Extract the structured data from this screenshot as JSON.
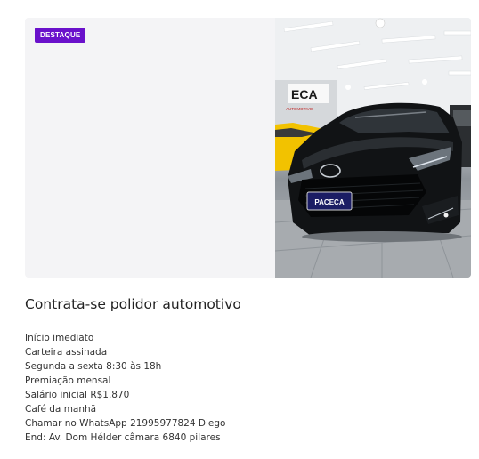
{
  "listing": {
    "badge": "DESTAQUE",
    "title": "Contrata-se polidor automotivo",
    "image_alt": "Toyota Corolla preto em oficina de polimento",
    "plate_text": "PACECA",
    "wall_sign": "ECA",
    "wall_sub": "AUTOMOTIVO",
    "description": [
      "Início imediato",
      "Carteira assinada",
      "Segunda a sexta 8:30 às 18h",
      "Premiação mensal",
      "Salário inicial R$1.870",
      "Café da manhã",
      "Chamar no WhatsApp 21995977824 Diego",
      "End: Av. Dom Hélder câmara 6840 pilares"
    ]
  },
  "colors": {
    "badge_bg": "#6a11cb",
    "card_bg": "#f4f4f6",
    "car_body": "#111315",
    "yellow_car": "#f2c200"
  }
}
